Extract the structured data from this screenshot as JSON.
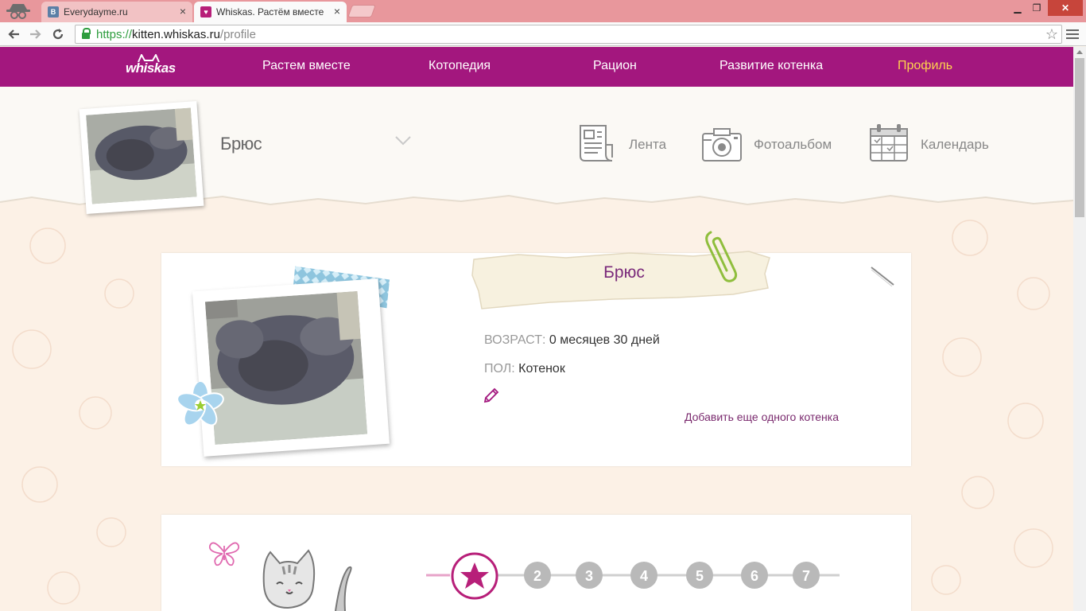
{
  "browser": {
    "tabs": [
      {
        "title": "Everydayme.ru",
        "favicon": "vk-icon",
        "active": false
      },
      {
        "title": "Whiskas. Растём вместе",
        "favicon": "whiskas-icon",
        "active": true
      }
    ],
    "close_glyph": "×",
    "url": {
      "scheme": "https://",
      "host": "kitten.whiskas.ru",
      "path": "/profile"
    },
    "window_controls": {
      "minimize": "▁",
      "maximize": "❐",
      "close": "✕"
    }
  },
  "site_nav": {
    "logo": "whiskas",
    "items": [
      {
        "label": "Растем вместе",
        "active": false
      },
      {
        "label": "Котопедия",
        "active": false
      },
      {
        "label": "Рацион",
        "active": false
      },
      {
        "label": "Развитие котенка",
        "active": false
      },
      {
        "label": "Профиль",
        "active": true
      }
    ],
    "active_color": "#ffd34d",
    "bar_color": "#a3177e"
  },
  "profile_header": {
    "pet_name": "Брюс",
    "links": [
      {
        "label": "Лента",
        "icon": "newspaper-icon"
      },
      {
        "label": "Фотоальбом",
        "icon": "camera-icon"
      },
      {
        "label": "Календарь",
        "icon": "calendar-icon"
      }
    ]
  },
  "profile_card": {
    "name": "Брюс",
    "age_label": "ВОЗРАСТ:",
    "age_value": "0 месяцев 30 дней",
    "sex_label": "ПОЛ:",
    "sex_value": "Котенок",
    "add_link": "Добавить еще одного котенка"
  },
  "steps": {
    "current": 1,
    "items": [
      "",
      "2",
      "3",
      "4",
      "5",
      "6",
      "7"
    ],
    "accent_color": "#b71f79"
  }
}
